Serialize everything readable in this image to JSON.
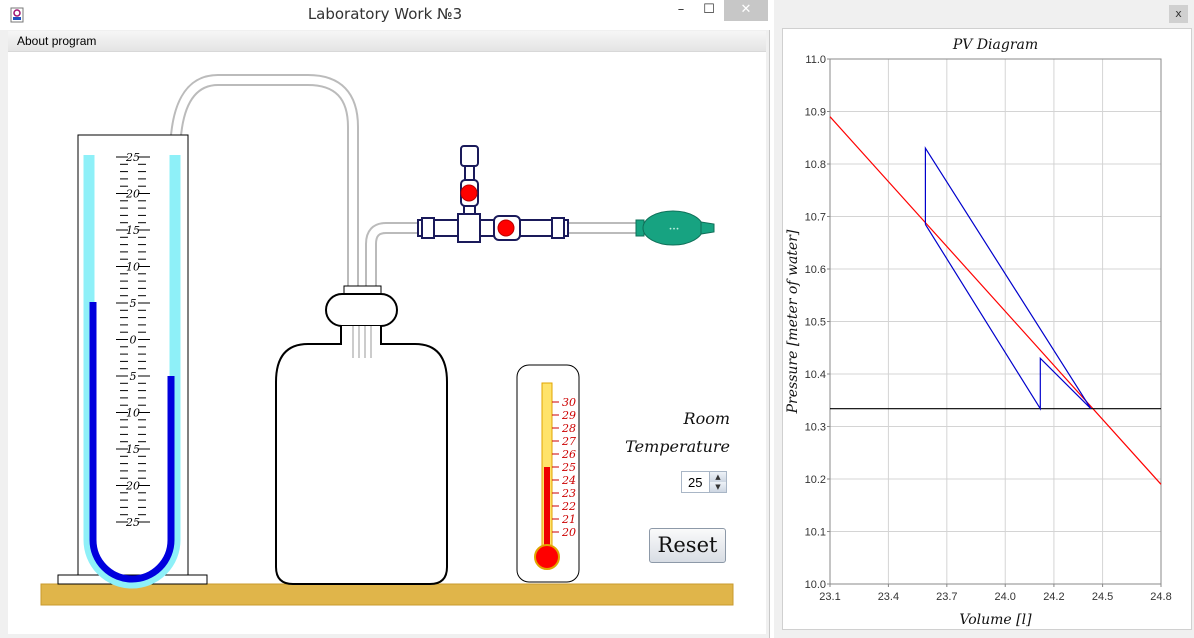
{
  "window": {
    "title": "Laboratory Work №3",
    "min_label": "–",
    "max_label": "☐",
    "close_label": "✕"
  },
  "menu": {
    "about_label": "About program"
  },
  "manometer": {
    "ticks": [
      "25",
      "20",
      "15",
      "10",
      "5",
      "0",
      "5",
      "10",
      "15",
      "20",
      "25"
    ],
    "left_level": 5,
    "right_level": -5
  },
  "thermometer": {
    "ticks": [
      "30",
      "29",
      "28",
      "27",
      "26",
      "25",
      "24",
      "23",
      "22",
      "21",
      "20"
    ],
    "reading": 25,
    "tick_color": "#cc0000"
  },
  "controls": {
    "room_label": "Room",
    "temperature_label": "Temperature",
    "temperature_value": "25",
    "reset_label": "Reset"
  },
  "chart_window": {
    "close_label": "x"
  },
  "chart_data": {
    "type": "line",
    "title": "PV Diagram",
    "xlabel": "Volume [l]",
    "ylabel": "Pressure [meter of water]",
    "xlim": [
      23.1,
      24.8
    ],
    "ylim": [
      10.0,
      11.0
    ],
    "x_ticks": [
      "23.1",
      "23.4",
      "23.7",
      "24.0",
      "24.2",
      "24.5",
      "24.8"
    ],
    "x_tick_values": [
      23.1,
      23.4,
      23.7,
      24.0,
      24.25,
      24.5,
      24.8
    ],
    "y_ticks": [
      "10.0",
      "10.1",
      "10.2",
      "10.3",
      "10.4",
      "10.5",
      "10.6",
      "10.7",
      "10.8",
      "10.9",
      "11.0"
    ],
    "grid": true,
    "series": [
      {
        "color": "#ff0000",
        "x": [
          23.1,
          24.8
        ],
        "y": [
          10.89,
          10.19
        ]
      },
      {
        "color": "#000000",
        "x": [
          23.1,
          24.8
        ],
        "y": [
          10.334,
          10.334
        ]
      },
      {
        "color": "#0000cc",
        "x": [
          23.59,
          23.59,
          24.44,
          24.18,
          24.18,
          23.59
        ],
        "y": [
          10.685,
          10.83,
          10.334,
          10.43,
          10.334,
          10.685
        ]
      }
    ]
  }
}
